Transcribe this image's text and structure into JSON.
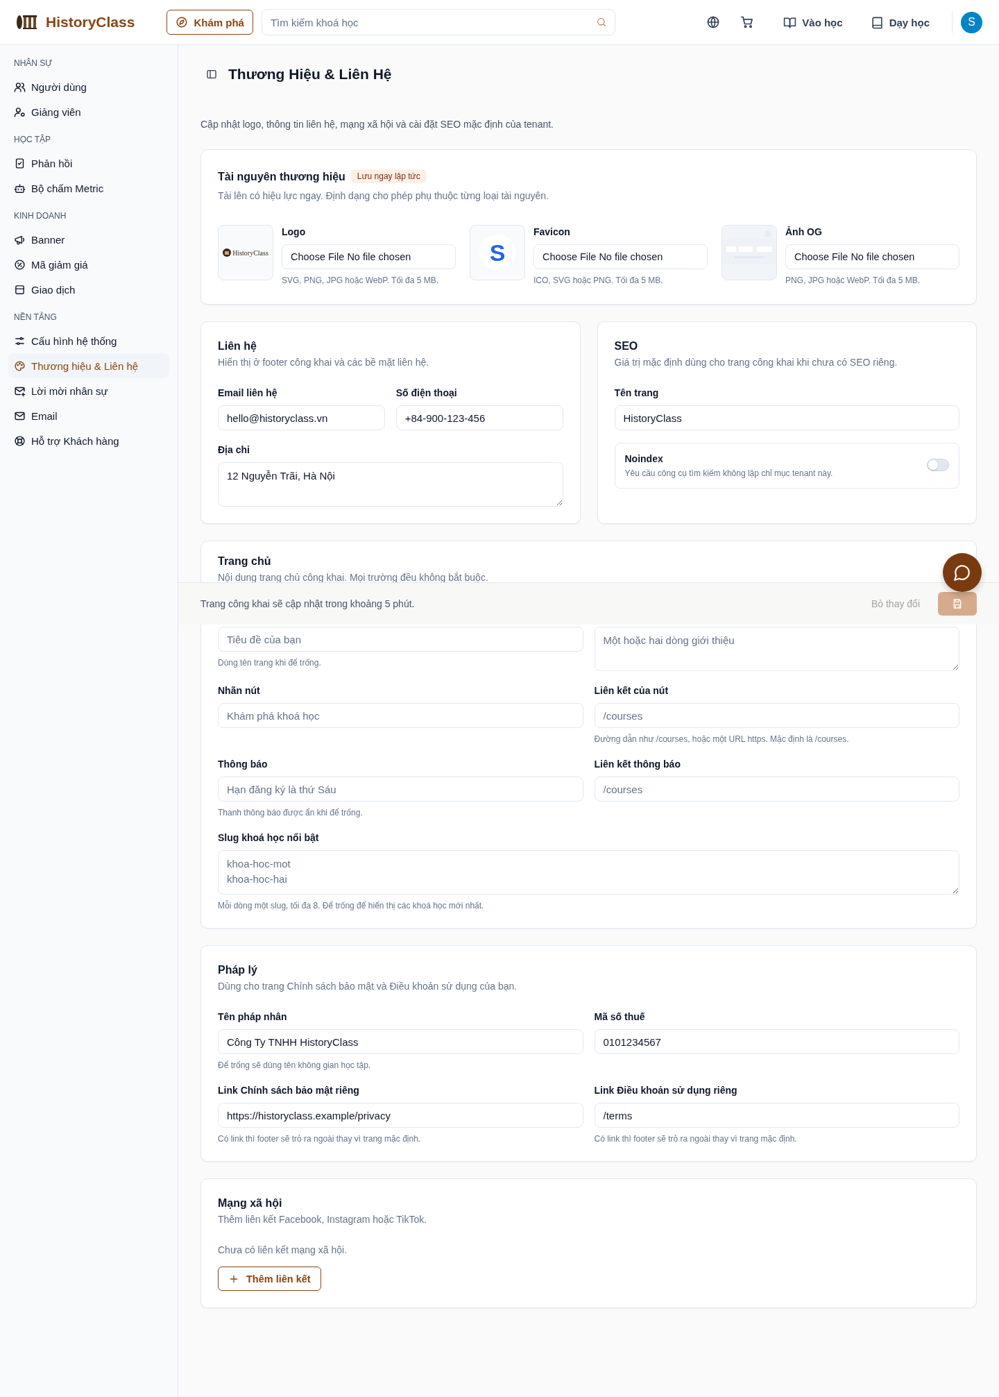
{
  "header": {
    "brand": "HistoryClass",
    "explore": "Khám phá",
    "search_placeholder": "Tìm kiếm khoá học",
    "links": [
      {
        "label": "Vào học"
      },
      {
        "label": "Dạy học"
      }
    ],
    "avatar": "S"
  },
  "sidebar": {
    "sections": [
      {
        "heading": "NHÂN SỰ",
        "items": [
          {
            "label": "Người dùng",
            "selected": false
          },
          {
            "label": "Giảng viên",
            "selected": false
          }
        ]
      },
      {
        "heading": "HỌC TẬP",
        "items": [
          {
            "label": "Phản hồi",
            "selected": false
          },
          {
            "label": "Bộ chấm Metric",
            "selected": false
          }
        ]
      },
      {
        "heading": "KINH DOANH",
        "items": [
          {
            "label": "Banner",
            "selected": false
          },
          {
            "label": "Mã giảm giá",
            "selected": false
          },
          {
            "label": "Giao dịch",
            "selected": false
          }
        ]
      },
      {
        "heading": "NỀN TẢNG",
        "items": [
          {
            "label": "Cấu hình hệ thống",
            "selected": false
          },
          {
            "label": "Thương hiệu & Liên hệ",
            "selected": true
          },
          {
            "label": "Lời mời nhân sự",
            "selected": false
          },
          {
            "label": "Email",
            "selected": false
          },
          {
            "label": "Hỗ trợ Khách hàng",
            "selected": false
          }
        ]
      }
    ]
  },
  "page": {
    "title": "Thương Hiệu & Liên Hệ",
    "description": "Cập nhật logo, thông tin liên hệ, mạng xã hội và cài đặt SEO mặc định của tenant."
  },
  "brand_assets": {
    "title": "Tài nguyên thương hiệu",
    "badge": "Lưu ngay lập tức",
    "subtitle": "Tải lên có hiệu lực ngay. Định dạng cho phép phụ thuộc từng loại tài nguyên.",
    "assets": [
      {
        "kind": "logo",
        "label": "Logo",
        "preview_text": "HistoryClass",
        "file_text": "Choose File No file chosen",
        "hint": "SVG, PNG, JPG hoặc WebP. Tối đa 5 MB."
      },
      {
        "kind": "favicon",
        "label": "Favicon",
        "preview_text": "S",
        "file_text": "Choose File No file chosen",
        "hint": "ICO, SVG hoặc PNG. Tối đa 5 MB."
      },
      {
        "kind": "picture",
        "label": "Ảnh OG",
        "file_text": "Choose File No file chosen",
        "hint": "PNG, JPG hoặc WebP. Tối đa 5 MB."
      }
    ]
  },
  "contact": {
    "title": "Liên hệ",
    "subtitle": "Hiển thị ở footer công khai và các bề mặt liên hệ.",
    "rows": [
      [
        {
          "kind": "input",
          "label": "Email liên hệ",
          "value": "hello@historyclass.vn"
        },
        {
          "kind": "input",
          "label": "Số điện thoại",
          "value": "+84-900-123-456"
        }
      ],
      [
        {
          "kind": "textarea",
          "label": "Địa chỉ",
          "value": "12 Nguyễn Trãi, Hà Nội"
        }
      ]
    ]
  },
  "seo": {
    "title": "SEO",
    "subtitle": "Giá trị mặc định dùng cho trang công khai khi chưa có SEO riêng.",
    "rows": [
      [
        {
          "kind": "input",
          "label": "Tên trang",
          "value": "HistoryClass"
        }
      ]
    ],
    "noindex": {
      "label": "Noindex",
      "description": "Yêu cầu công cụ tìm kiếm không lập chỉ mục tenant này.",
      "on": false
    }
  },
  "home": {
    "title": "Trang chủ",
    "subtitle": "Nội dung trang chủ công khai. Mọi trường đều không bắt buộc.",
    "rows": [
      [
        {
          "kind": "input",
          "placeholder": "Tiêu đề của bạn",
          "hint": "Dùng tên trang khi để trống."
        },
        {
          "kind": "textarea",
          "placeholder": "Một hoặc hai dòng giới thiệu"
        }
      ],
      [
        {
          "kind": "input",
          "label": "Nhãn nút",
          "placeholder": "Khám phá khoá học"
        },
        {
          "kind": "input",
          "label": "Liên kết của nút",
          "placeholder": "/courses",
          "hint": "Đường dẫn như /courses, hoặc một URL https. Mặc định là /courses."
        }
      ],
      [
        {
          "kind": "input",
          "label": "Thông báo",
          "placeholder": "Hạn đăng ký là thứ Sáu",
          "hint": "Thanh thông báo được ẩn khi để trống."
        },
        {
          "kind": "input",
          "label": "Liên kết thông báo",
          "placeholder": "/courses"
        }
      ],
      [
        {
          "kind": "textarea",
          "label": "Slug khoá học nổi bật",
          "placeholder": "khoa-hoc-mot\nkhoa-hoc-hai",
          "hint": "Mỗi dòng một slug, tối đa 8. Để trống để hiển thị các khoá học mới nhất."
        }
      ]
    ]
  },
  "legal": {
    "title": "Pháp lý",
    "subtitle": "Dùng cho trang Chính sách bảo mật và Điều khoản sử dụng của bạn.",
    "rows": [
      [
        {
          "kind": "input",
          "label": "Tên pháp nhân",
          "value": "Công Ty TNHH HistoryClass",
          "hint": "Để trống sẽ dùng tên không gian học tập."
        },
        {
          "kind": "input",
          "label": "Mã số thuế",
          "value": "0101234567"
        }
      ],
      [
        {
          "kind": "input",
          "label": "Link Chính sách bảo mật riêng",
          "value": "https://historyclass.example/privacy",
          "hint": "Có link thì footer sẽ trỏ ra ngoài thay vì trang mặc định."
        },
        {
          "kind": "input",
          "label": "Link Điều khoản sử dụng riêng",
          "value": "/terms",
          "hint": "Có link thì footer sẽ trỏ ra ngoài thay vì trang mặc định."
        }
      ]
    ]
  },
  "social": {
    "title": "Mạng xã hội",
    "subtitle": "Thêm liên kết Facebook, Instagram hoặc TikTok.",
    "empty_text": "Chưa có liên kết mạng xã hội.",
    "add_button": "Thêm liên kết"
  },
  "savebar": {
    "message": "Trang công khai sẽ cập nhật trong khoảng 5 phút.",
    "discard": {
      "label": "Bỏ thay đổi",
      "disabled": true
    },
    "save": {
      "disabled": true
    }
  }
}
